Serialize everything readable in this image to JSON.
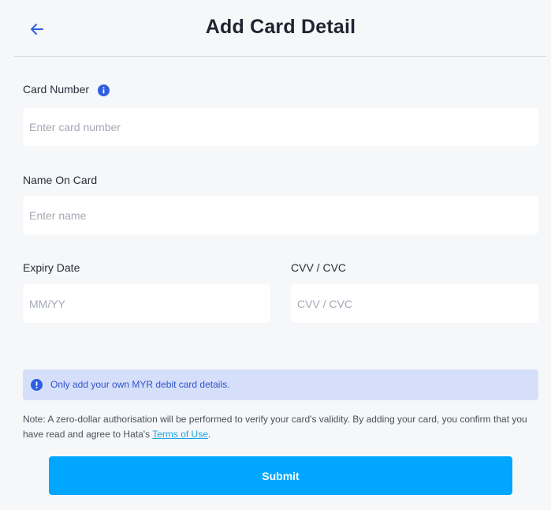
{
  "header": {
    "title": "Add Card Detail",
    "back_icon": "arrow-left-icon"
  },
  "form": {
    "card_number": {
      "label": "Card Number",
      "placeholder": "Enter card number",
      "value": "",
      "info_icon": "info-icon"
    },
    "name_on_card": {
      "label": "Name On Card",
      "placeholder": "Enter name",
      "value": ""
    },
    "expiry_date": {
      "label": "Expiry Date",
      "placeholder": "MM/YY",
      "value": ""
    },
    "cvv": {
      "label": "CVV / CVC",
      "placeholder": "CVV / CVC",
      "value": ""
    }
  },
  "notice": {
    "icon": "exclamation-icon",
    "text": "Only add your own MYR debit card details."
  },
  "note": {
    "text_before": "Note: A zero-dollar authorisation will be performed to verify your card's validity. By adding your card, you confirm that you have read and agree to Hata's ",
    "link_text": "Terms of Use",
    "text_after": "."
  },
  "submit": {
    "label": "Submit"
  },
  "colors": {
    "accent": "#00a6ff",
    "info_blue": "#2f5fe0",
    "notice_bg": "#d6dffa",
    "link": "#1ba3e0",
    "page_bg": "#f6f7f9"
  }
}
